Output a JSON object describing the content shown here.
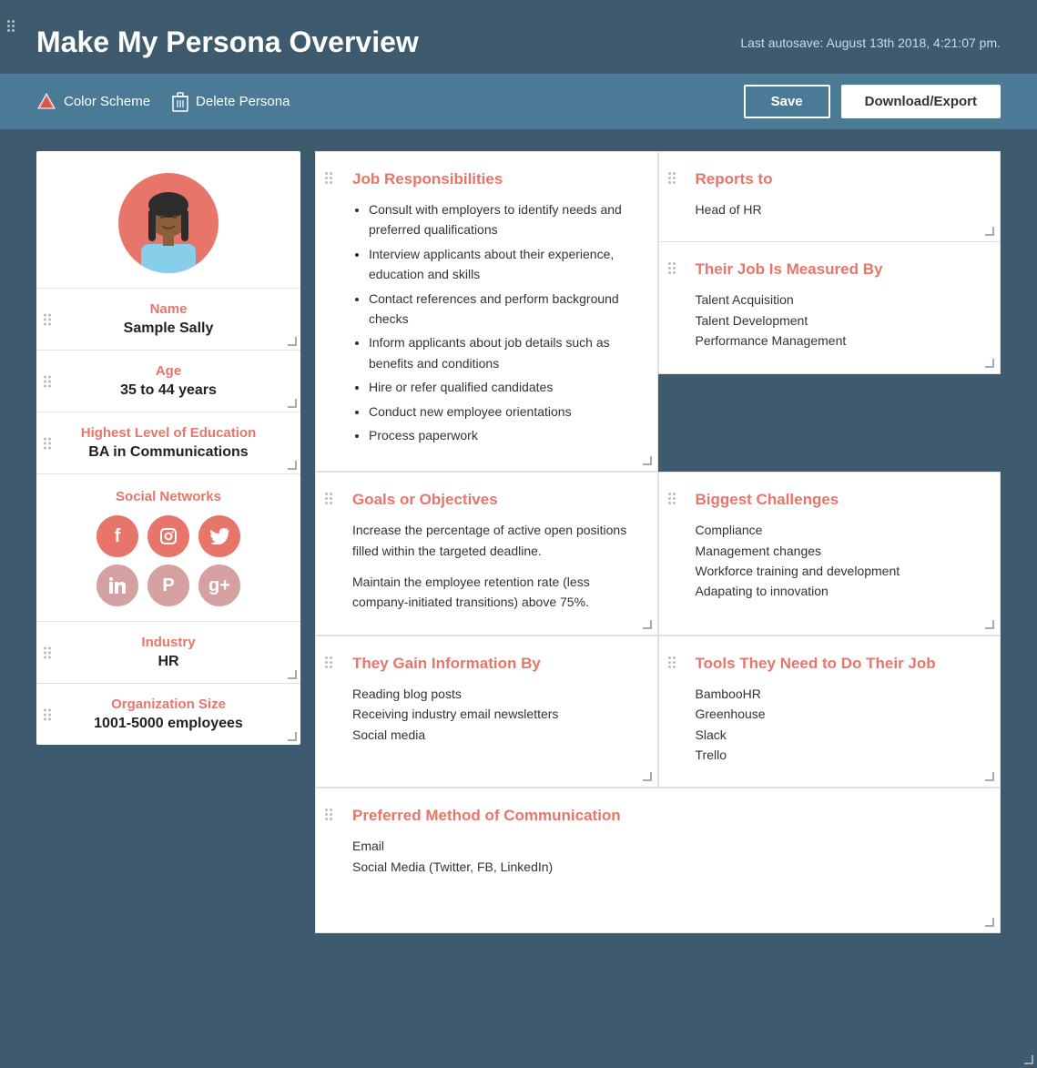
{
  "header": {
    "title": "Make My Persona Overview",
    "autosave": "Last autosave: August 13th 2018, 4:21:07 pm."
  },
  "toolbar": {
    "color_scheme_label": "Color Scheme",
    "delete_persona_label": "Delete Persona",
    "save_label": "Save",
    "download_label": "Download/Export"
  },
  "left_col": {
    "name_label": "Name",
    "name_value": "Sample Sally",
    "age_label": "Age",
    "age_value": "35 to 44 years",
    "education_label": "Highest Level of Education",
    "education_value": "BA in Communications",
    "social_label": "Social Networks",
    "industry_label": "Industry",
    "industry_value": "HR",
    "org_size_label": "Organization Size",
    "org_size_value": "1001-5000 employees"
  },
  "cards": {
    "job_responsibilities": {
      "title": "Job Responsibilities",
      "items": [
        "Consult with employers to identify needs and preferred qualifications",
        "Interview applicants about their experience, education and skills",
        "Contact references and perform background checks",
        "Inform applicants about job details such as benefits and conditions",
        "Hire or refer qualified candidates",
        "Conduct new employee orientations",
        "Process paperwork"
      ]
    },
    "reports_to": {
      "title": "Reports to",
      "value": "Head of HR"
    },
    "job_measured_by": {
      "title": "Their Job Is Measured By",
      "items": [
        "Talent Acquisition",
        "Talent Development",
        "Performance Management"
      ]
    },
    "goals": {
      "title": "Goals or Objectives",
      "para1": "Increase the percentage of active open positions filled within the targeted deadline.",
      "para2": "Maintain the employee retention rate (less company-initiated transitions) above 75%."
    },
    "biggest_challenges": {
      "title": "Biggest Challenges",
      "items": [
        "Compliance",
        "Management changes",
        "Workforce training and development",
        "Adapating to innovation"
      ]
    },
    "gain_info": {
      "title": "They Gain Information By",
      "items": [
        "Reading blog posts",
        "Receiving industry email newsletters",
        "Social media"
      ]
    },
    "tools": {
      "title": "Tools They Need to Do Their Job",
      "items": [
        "BambooHR",
        "Greenhouse",
        "Slack",
        "Trello"
      ]
    },
    "communication": {
      "title": "Preferred Method of Communication",
      "items": [
        "Email",
        "Social Media (Twitter, FB, LinkedIn)"
      ]
    }
  }
}
